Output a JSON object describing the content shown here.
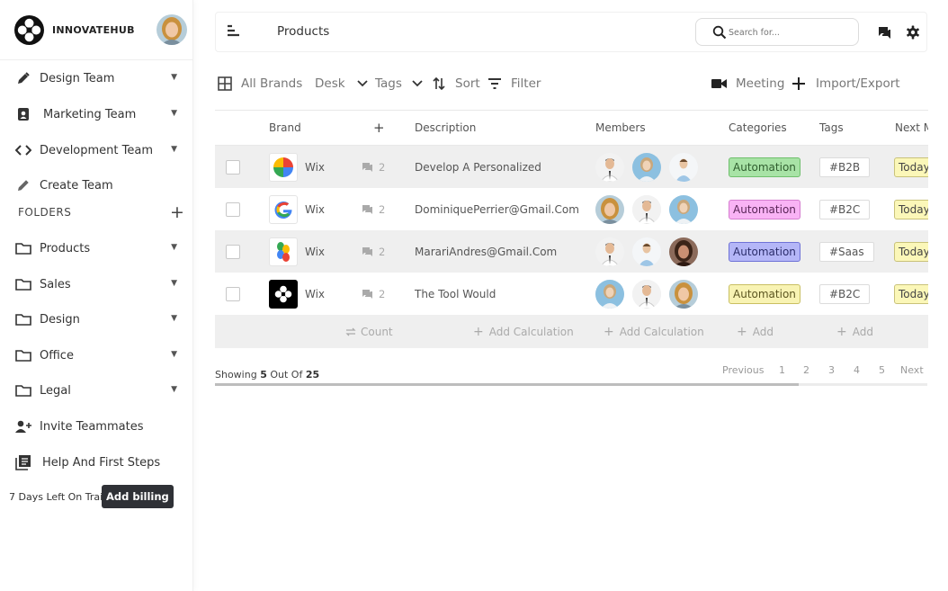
{
  "brand": {
    "name": "INNOVATEHUB"
  },
  "sidebar": {
    "items": [
      {
        "label": "Design Team"
      },
      {
        "label": "Marketing Team"
      },
      {
        "label": "Development Team"
      },
      {
        "label": "Create Team"
      }
    ],
    "folders_label": "FOLDERS",
    "folders": [
      {
        "label": "Products"
      },
      {
        "label": "Sales"
      },
      {
        "label": "Design"
      },
      {
        "label": "Office"
      },
      {
        "label": "Legal"
      }
    ],
    "invite_label": "Invite Teammates",
    "help_label": "Help And First Steps",
    "trail_text": "7 Days Left On Trail",
    "billing_label": "Add billing"
  },
  "header": {
    "title": "Products",
    "search_placeholder": "Search for..."
  },
  "toolbar": {
    "all_brands": "All Brands",
    "desk": "Desk",
    "tags": "Tags",
    "sort": "Sort",
    "filter": "Filter",
    "meeting": "Meeting",
    "import_export": "Import/Export"
  },
  "table": {
    "columns": [
      "Brand",
      "+",
      "Description",
      "Members",
      "Categories",
      "Tags",
      "Next M"
    ],
    "rows": [
      {
        "brand": "Wix",
        "logo": "pinwheel-logo",
        "comments": "2",
        "description": "Develop A Personalized",
        "category": "Automation",
        "category_color": "#a8e3a6",
        "tag": "#B2B",
        "next": "Today"
      },
      {
        "brand": "Wix",
        "logo": "google-logo",
        "comments": "2",
        "description": "DominiquePerrier@Gmail.Com",
        "category": "Automation",
        "category_color": "#f9b3f5",
        "tag": "#B2C",
        "next": "Today"
      },
      {
        "brand": "Wix",
        "logo": "bean-logo",
        "comments": "2",
        "description": "MarariAndres@Gmail.Com",
        "category": "Automation",
        "category_color": "#b4b6f7",
        "tag": "#Saas",
        "next": "Today"
      },
      {
        "brand": "Wix",
        "logo": "dark-logo",
        "comments": "2",
        "description": "The Tool Would",
        "category": "Automation",
        "category_color": "#f8f3b3",
        "tag": "#B2C",
        "next": "Today"
      }
    ],
    "footer": {
      "count": "Count",
      "add_calc_1": "Add Calculation",
      "add_calc_2": "Add Calculation",
      "add_1": "Add",
      "add_2": "Add"
    }
  },
  "pagination": {
    "showing_prefix": "Showing",
    "shown": "5",
    "out_of": "Out Of",
    "total": "25",
    "previous": "Previous",
    "pages": [
      "1",
      "2",
      "3",
      "4",
      "5"
    ],
    "next": "Next",
    "scroll_fraction": 0.82
  }
}
